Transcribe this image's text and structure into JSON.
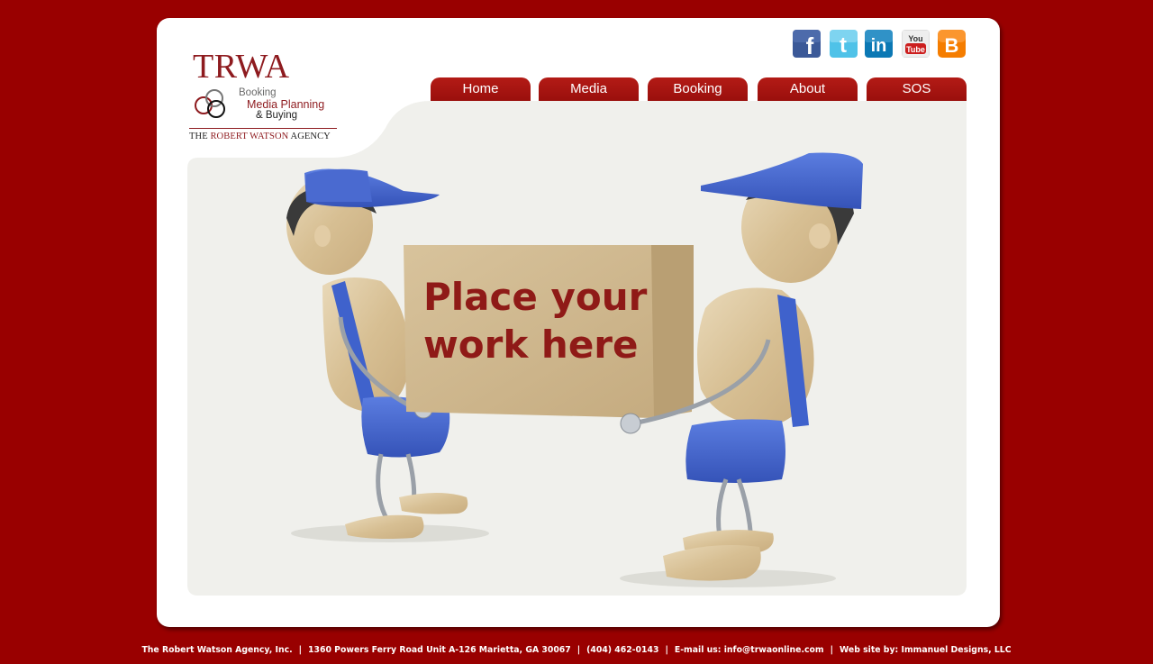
{
  "logo": {
    "title": "TRWA",
    "line1": "Booking",
    "line2": "Media Planning",
    "line3": "& Buying",
    "agency_prefix": "THE ",
    "agency_name": "ROBERT WATSON",
    "agency_suffix": " AGENCY"
  },
  "social": [
    {
      "icon": "facebook-icon",
      "label": "f"
    },
    {
      "icon": "twitter-icon",
      "label": "t"
    },
    {
      "icon": "linkedin-icon",
      "label": "in"
    },
    {
      "icon": "youtube-icon",
      "label_top": "You",
      "label_bottom": "Tube"
    },
    {
      "icon": "blogger-icon",
      "label": "B"
    }
  ],
  "nav": {
    "home": "Home",
    "media": "Media",
    "booking": "Booking",
    "about": "About",
    "sos": "SOS"
  },
  "hero": {
    "box_line1": "Place your",
    "box_line2": "work here"
  },
  "footer": {
    "company": "The Robert Watson Agency, Inc.",
    "address": "1360 Powers Ferry Road Unit A-126 Marietta, GA 30067",
    "phone": "(404) 462-0143",
    "email": "E-mail us: info@trwaonline.com",
    "credit": "Web site by: Immanuel Designs, LLC"
  },
  "colors": {
    "page_bg": "#990000",
    "brand_red": "#8e1b1f",
    "tab_red": "#a8130f",
    "stage_bg": "#f0f0ec"
  }
}
